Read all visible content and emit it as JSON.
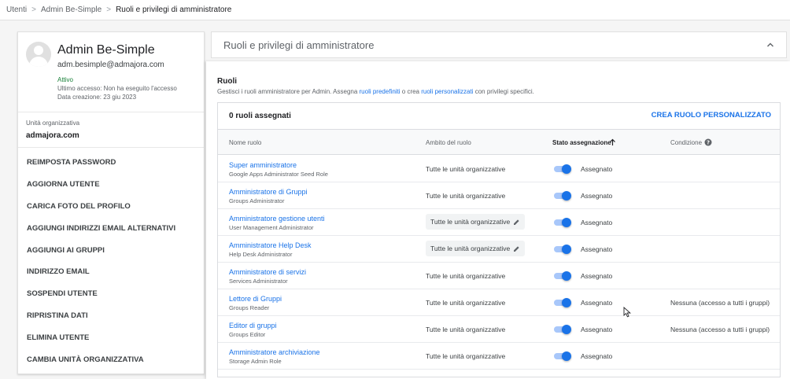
{
  "breadcrumb": {
    "items": [
      "Utenti",
      "Admin Be-Simple"
    ],
    "current": "Ruoli e privilegi di amministratore",
    "separator": ">"
  },
  "user": {
    "name": "Admin Be-Simple",
    "email": "adm.besimple@admajora.com",
    "status": "Attivo",
    "last_login": "Ultimo accesso: Non ha eseguito l'accesso",
    "created": "Data creazione: 23 giu 2023",
    "org_unit_label": "Unità organizzativa",
    "org_unit_value": "admajora.com"
  },
  "actions": [
    "REIMPOSTA PASSWORD",
    "AGGIORNA UTENTE",
    "CARICA FOTO DEL PROFILO",
    "AGGIUNGI INDIRIZZI EMAIL ALTERNATIVI",
    "AGGIUNGI AI GRUPPI",
    "INDIRIZZO EMAIL",
    "SOSPENDI UTENTE",
    "RIPRISTINA DATI",
    "ELIMINA UTENTE",
    "CAMBIA UNITÀ ORGANIZZATIVA"
  ],
  "panel": {
    "title": "Ruoli e privilegi di amministratore",
    "roles_title": "Ruoli",
    "desc_before": "Gestisci i ruoli amministratore per Admin. Assegna ",
    "desc_link1": "ruoli predefiniti",
    "desc_middle": " o crea ",
    "desc_link2": "ruoli personalizzati",
    "desc_after": " con privilegi specifici.",
    "assigned_count": "0 ruoli assegnati",
    "create_button": "CREA RUOLO PERSONALIZZATO"
  },
  "columns": {
    "name": "Nome ruolo",
    "scope": "Ambito del ruolo",
    "status": "Stato assegnazione",
    "condition": "Condizione"
  },
  "roles": [
    {
      "name": "Super amministratore",
      "sub": "Google Apps Administrator Seed Role",
      "scope": "Tutte le unità organizzative",
      "editable": false,
      "status": "Assegnato",
      "condition": ""
    },
    {
      "name": "Amministratore di Gruppi",
      "sub": "Groups Administrator",
      "scope": "Tutte le unità organizzative",
      "editable": false,
      "status": "Assegnato",
      "condition": ""
    },
    {
      "name": "Amministratore gestione utenti",
      "sub": "User Management Administrator",
      "scope": "Tutte le unità organizzative",
      "editable": true,
      "status": "Assegnato",
      "condition": ""
    },
    {
      "name": "Amministratore Help Desk",
      "sub": "Help Desk Administrator",
      "scope": "Tutte le unità organizzative",
      "editable": true,
      "status": "Assegnato",
      "condition": ""
    },
    {
      "name": "Amministratore di servizi",
      "sub": "Services Administrator",
      "scope": "Tutte le unità organizzative",
      "editable": false,
      "status": "Assegnato",
      "condition": ""
    },
    {
      "name": "Lettore di Gruppi",
      "sub": "Groups Reader",
      "scope": "Tutte le unità organizzative",
      "editable": false,
      "status": "Assegnato",
      "condition": "Nessuna (accesso a tutti i gruppi)"
    },
    {
      "name": "Editor di gruppi",
      "sub": "Groups Editor",
      "scope": "Tutte le unità organizzative",
      "editable": false,
      "status": "Assegnato",
      "condition": "Nessuna (accesso a tutti i gruppi)"
    },
    {
      "name": "Amministratore archiviazione",
      "sub": "Storage Admin Role",
      "scope": "Tutte le unità organizzative",
      "editable": false,
      "status": "Assegnato",
      "condition": ""
    }
  ],
  "colors": {
    "accent": "#1a73e8",
    "toggle_track": "#a8c7fa",
    "status_active": "#188038"
  }
}
